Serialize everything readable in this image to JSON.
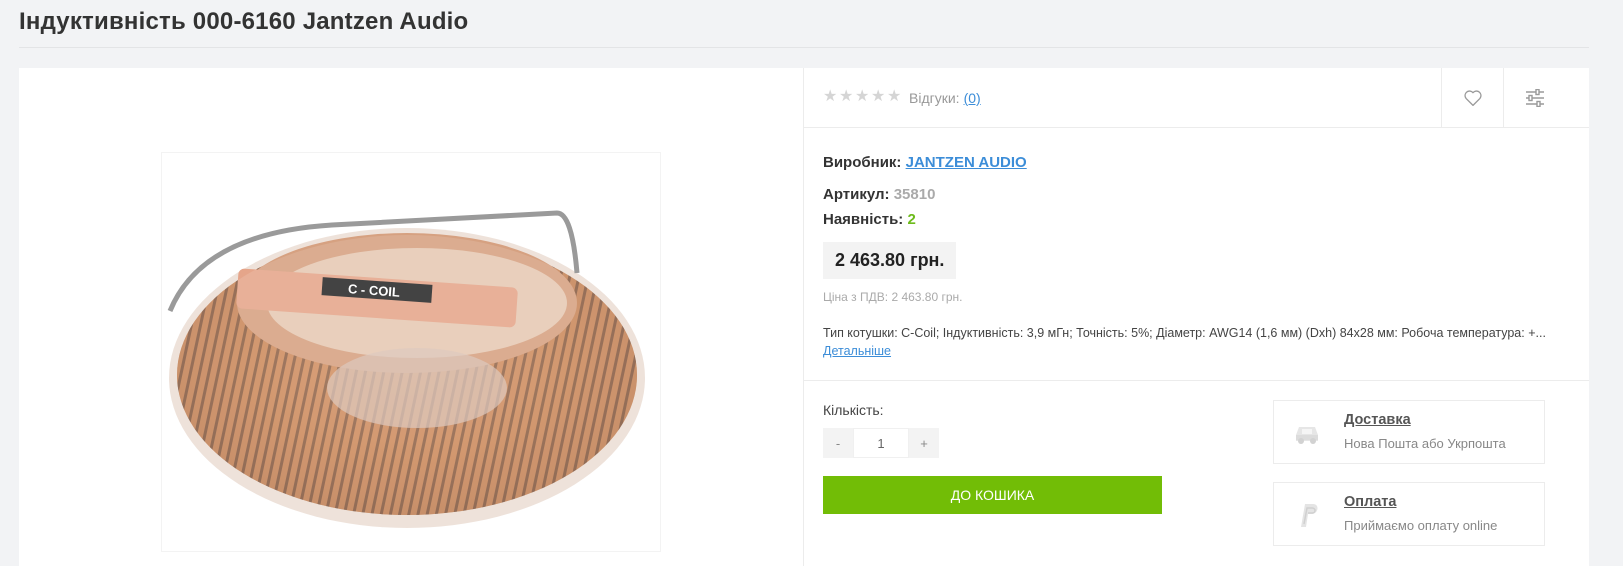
{
  "page": {
    "title": "Індуктивність 000-6160 Jantzen Audio"
  },
  "product": {
    "image_label": "C - COIL",
    "rating": {
      "stars": 0,
      "max": 5,
      "reviews_label": "Відгуки:",
      "reviews_count": "(0)"
    },
    "actions": {
      "wishlist": "heart-icon",
      "compare": "compare-sliders-icon"
    },
    "manufacturer_label": "Виробник:",
    "manufacturer": "JANTZEN AUDIO",
    "sku_label": "Артикул:",
    "sku": "35810",
    "stock_label": "Наявність:",
    "stock": "2",
    "price": "2 463.80 грн.",
    "vat_price": "Ціна з ПДВ: 2 463.80 грн.",
    "short_description": "Тип котушки: C-Coil; Індуктивність: 3,9 мГн; Точність: 5%; Діаметр: AWG14 (1,6 мм) (Dxh) 84x28 мм: Робоча температура: +...",
    "more_link": "Детальніше"
  },
  "purchase": {
    "qty_label": "Кількість:",
    "minus": "-",
    "qty_value": "1",
    "plus": "+",
    "add_to_cart": "ДО КОШИКА"
  },
  "services": [
    {
      "icon": "truck-icon",
      "title": "Доставка",
      "subtitle": "Нова Пошта або Укрпошта"
    },
    {
      "icon": "paypal-icon",
      "title": "Оплата",
      "subtitle": "Приймаємо оплату online"
    }
  ],
  "colors": {
    "accent_green": "#72bd06",
    "stock_green": "#6dbb1b",
    "link_blue": "#3c8dd8"
  }
}
